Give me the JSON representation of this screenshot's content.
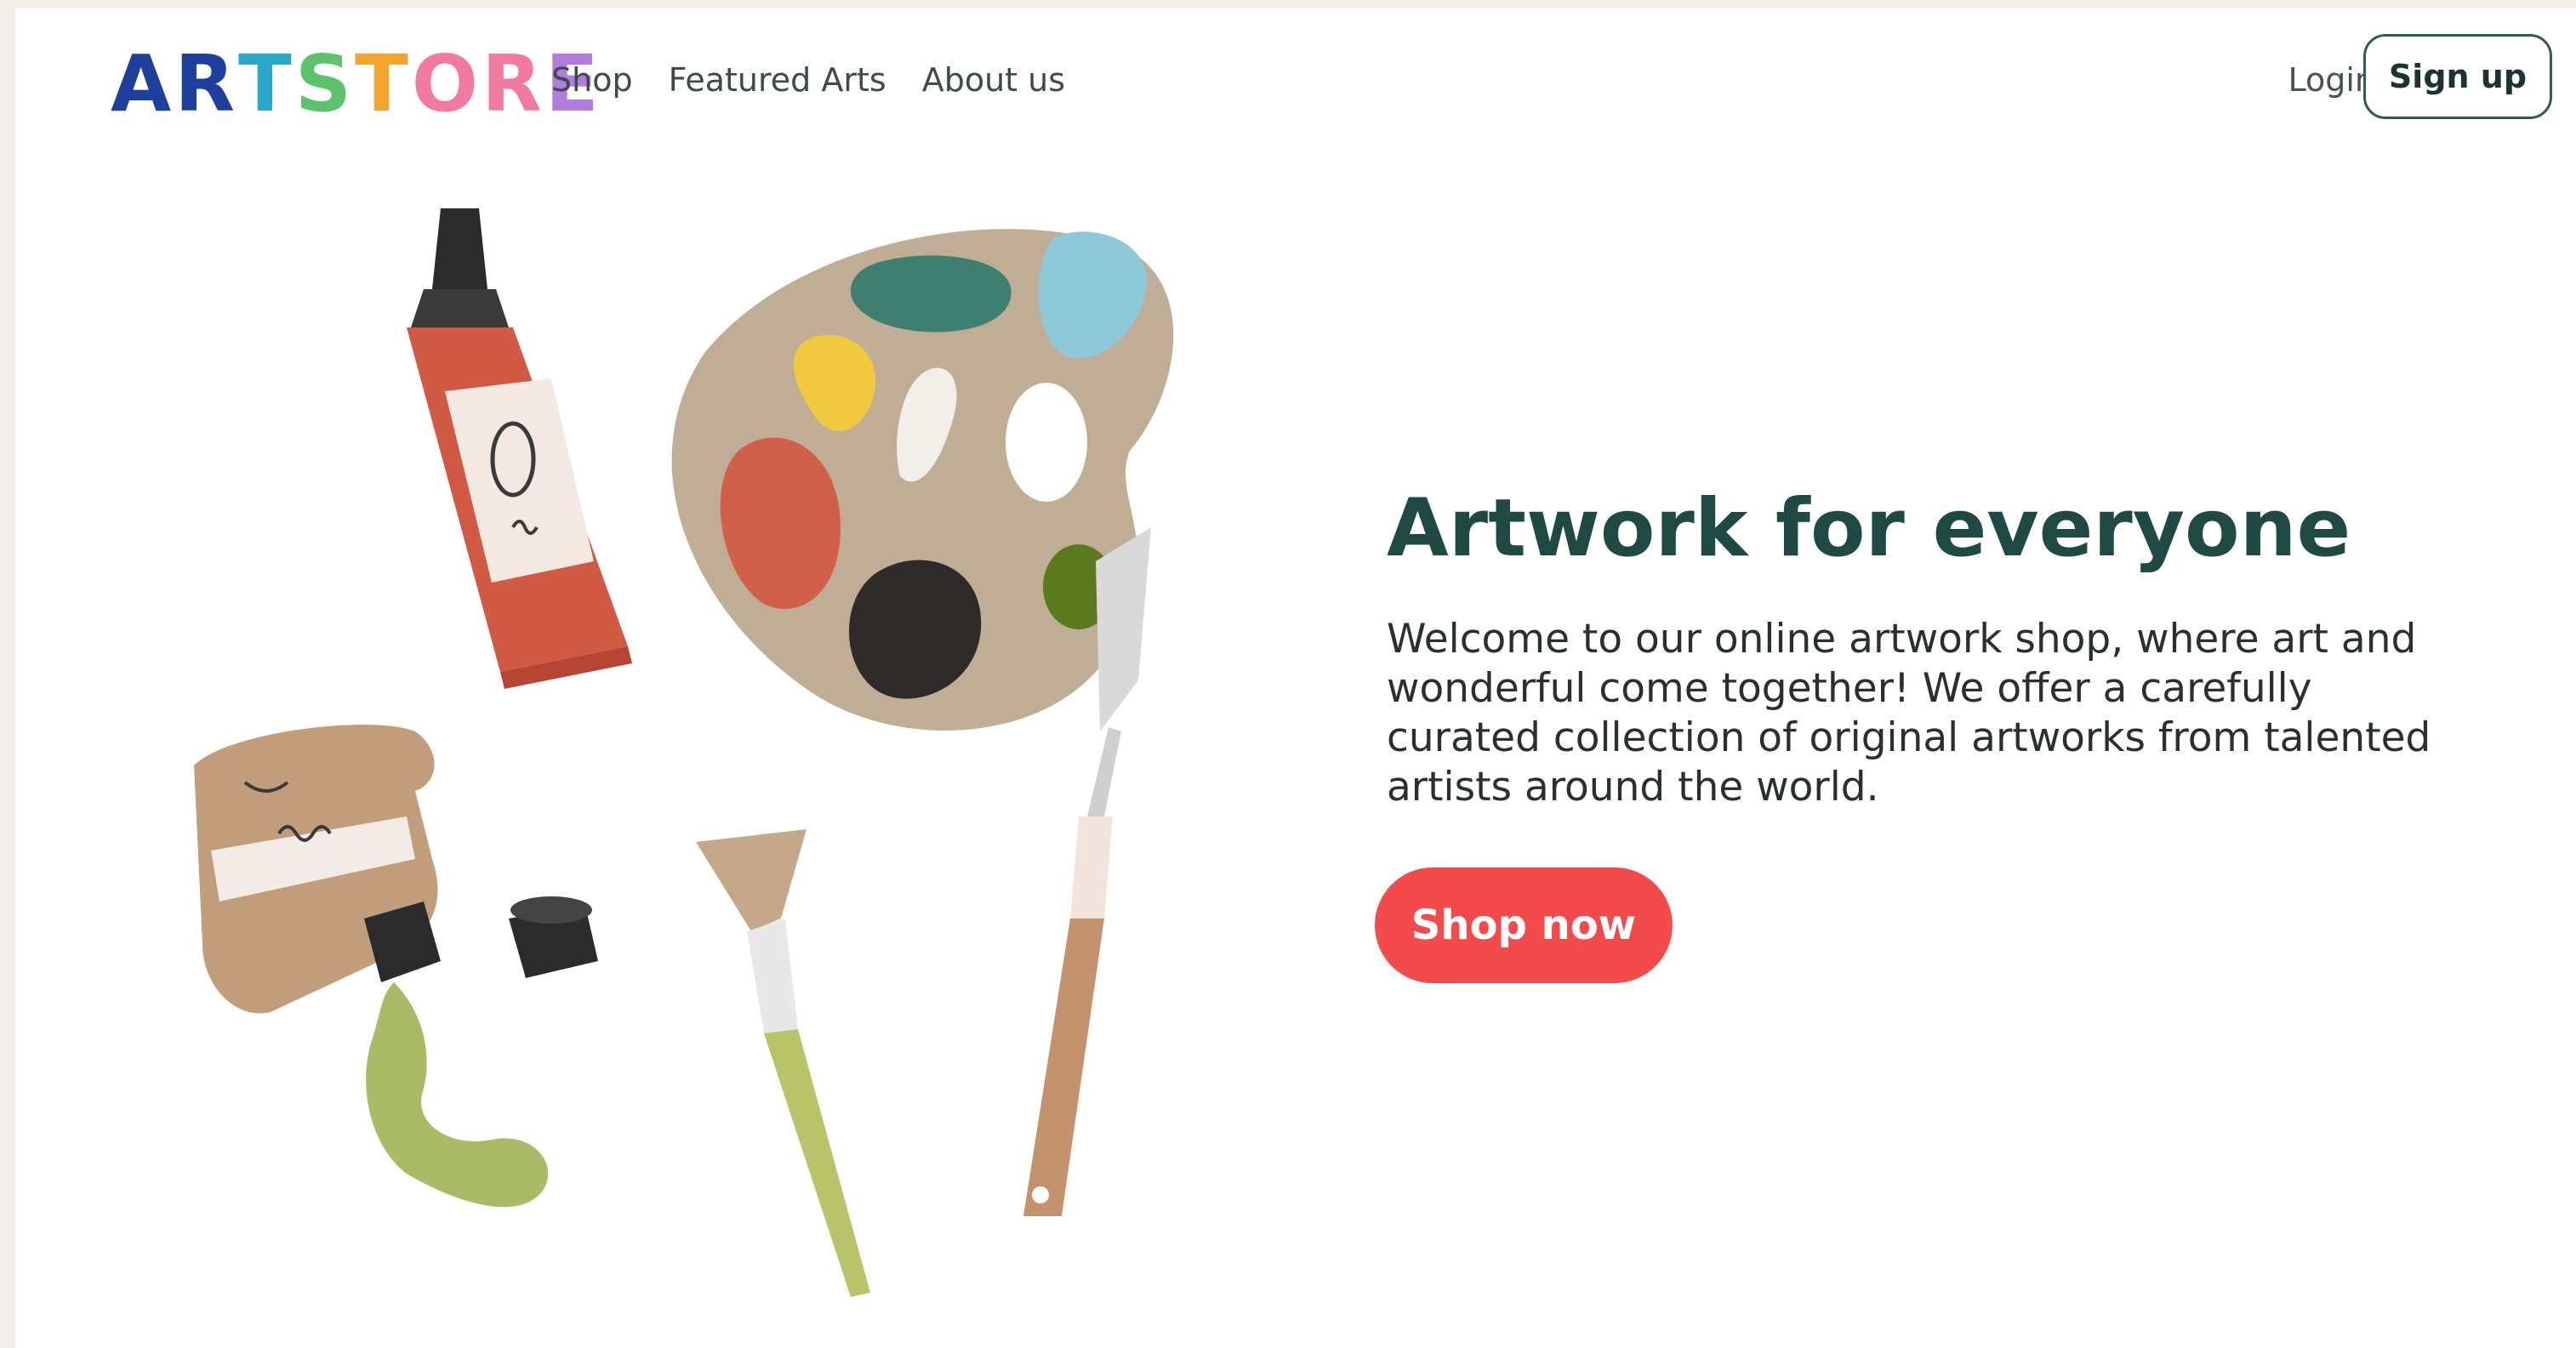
{
  "brand": {
    "logo_letters": [
      "A",
      "R",
      "T",
      "S",
      "T",
      "O",
      "R",
      "E"
    ],
    "logo_colors": [
      "#1f3f9e",
      "#1f3f9e",
      "#2aa8c9",
      "#5cc26b",
      "#f2a52a",
      "#f07aa0",
      "#f07aa0",
      "#b27be0"
    ]
  },
  "nav": {
    "links": [
      "Shop",
      "Featured Arts",
      "About us"
    ],
    "login_label": "Login",
    "signup_label": "Sign up"
  },
  "hero": {
    "title": "Artwork for everyone",
    "body": "Welcome to our online artwork shop, where art and wonderful come together! We offer a carefully curated collection of original artworks from talented artists around the world.",
    "cta_label": "Shop now"
  },
  "colors": {
    "title": "#1f4a44",
    "cta": "#f34b4b",
    "signup_border": "#2f5b54"
  },
  "illustration": {
    "items": [
      "paint-tube-red-icon",
      "paint-tube-tan-icon",
      "palette-icon",
      "fan-brush-icon",
      "palette-knife-icon",
      "tube-cap-icon"
    ]
  }
}
